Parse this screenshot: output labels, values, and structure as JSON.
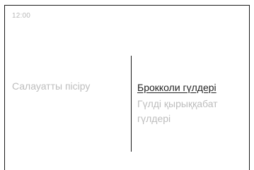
{
  "status_bar": {
    "time": "12:00"
  },
  "menu": {
    "category_label": "Салауатты пісіру",
    "items": [
      {
        "label": "Брокколи гүлдері",
        "selected": true
      },
      {
        "label": "Гүлді қырыққабат гүлдері",
        "selected": false
      }
    ]
  },
  "colors": {
    "active_text": "#222222",
    "inactive_text": "#bdbdbd",
    "frame": "#1a1a1a"
  }
}
